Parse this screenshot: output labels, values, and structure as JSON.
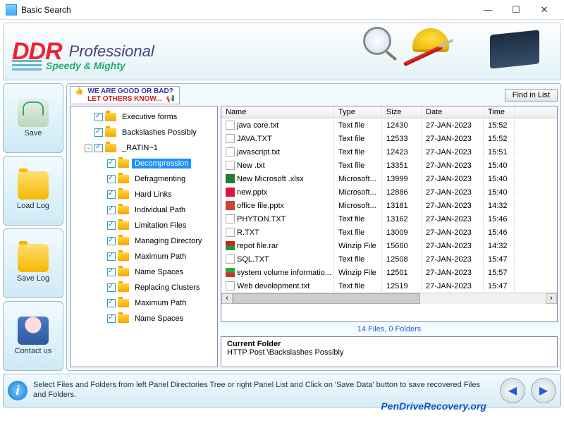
{
  "window": {
    "title": "Basic Search"
  },
  "banner": {
    "brand": "DDR",
    "product": "Professional",
    "slogan": "Speedy & Mighty"
  },
  "sidebar": [
    {
      "label": "Save",
      "icon": "drive"
    },
    {
      "label": "Load Log",
      "icon": "folder"
    },
    {
      "label": "Save Log",
      "icon": "folder"
    },
    {
      "label": "Contact us",
      "icon": "person"
    }
  ],
  "feedback": {
    "line1": "WE ARE GOOD OR BAD?",
    "line2": "LET OTHERS KNOW..."
  },
  "buttons": {
    "find": "Find in List"
  },
  "tree": [
    {
      "label": "Executive forms",
      "indent": 1,
      "exp": ""
    },
    {
      "label": "Backslashes Possibly",
      "indent": 1,
      "exp": ""
    },
    {
      "label": "_RATIN~1",
      "indent": 1,
      "exp": "-"
    },
    {
      "label": "Decompression",
      "indent": 2,
      "exp": "",
      "selected": true
    },
    {
      "label": "Defragmenting",
      "indent": 2,
      "exp": ""
    },
    {
      "label": "Hard Links",
      "indent": 2,
      "exp": ""
    },
    {
      "label": "Individual Path",
      "indent": 2,
      "exp": ""
    },
    {
      "label": "Limitation Files",
      "indent": 2,
      "exp": ""
    },
    {
      "label": "Managing Directory",
      "indent": 2,
      "exp": ""
    },
    {
      "label": "Maximum Path",
      "indent": 2,
      "exp": ""
    },
    {
      "label": "Name Spaces",
      "indent": 2,
      "exp": ""
    },
    {
      "label": "Replacing Clusters",
      "indent": 2,
      "exp": ""
    },
    {
      "label": "Maximum Path",
      "indent": 2,
      "exp": ""
    },
    {
      "label": "Name Spaces",
      "indent": 2,
      "exp": ""
    }
  ],
  "columns": {
    "name": "Name",
    "type": "Type",
    "size": "Size",
    "date": "Date",
    "time": "Time"
  },
  "files": [
    {
      "name": "java core.txt",
      "type": "Text file",
      "size": "12430",
      "date": "27-JAN-2023",
      "time": "15:52",
      "ic": "txt"
    },
    {
      "name": "JAVA.TXT",
      "type": "Text file",
      "size": "12533",
      "date": "27-JAN-2023",
      "time": "15:52",
      "ic": "txt"
    },
    {
      "name": "javascript.txt",
      "type": "Text file",
      "size": "12423",
      "date": "27-JAN-2023",
      "time": "15:51",
      "ic": "txt"
    },
    {
      "name": "New .txt",
      "type": "Text file",
      "size": "13351",
      "date": "27-JAN-2023",
      "time": "15:40",
      "ic": "txt"
    },
    {
      "name": "New Microsoft .xlsx",
      "type": "Microsoft...",
      "size": "13999",
      "date": "27-JAN-2023",
      "time": "15:40",
      "ic": "xls"
    },
    {
      "name": "new.pptx",
      "type": "Microsoft...",
      "size": "12886",
      "date": "27-JAN-2023",
      "time": "15:40",
      "ic": "ppt"
    },
    {
      "name": "office file.pptx",
      "type": "Microsoft...",
      "size": "13181",
      "date": "27-JAN-2023",
      "time": "14:32",
      "ic": "doc"
    },
    {
      "name": "PHYTON.TXT",
      "type": "Text file",
      "size": "13162",
      "date": "27-JAN-2023",
      "time": "15:46",
      "ic": "txt"
    },
    {
      "name": "R.TXT",
      "type": "Text file",
      "size": "13009",
      "date": "27-JAN-2023",
      "time": "15:46",
      "ic": "txt"
    },
    {
      "name": "repot file.rar",
      "type": "Winzip File",
      "size": "15660",
      "date": "27-JAN-2023",
      "time": "14:32",
      "ic": "rar"
    },
    {
      "name": "SQL.TXT",
      "type": "Text file",
      "size": "12508",
      "date": "27-JAN-2023",
      "time": "15:47",
      "ic": "txt"
    },
    {
      "name": "system volume informatio...",
      "type": "Winzip File",
      "size": "12501",
      "date": "27-JAN-2023",
      "time": "15:57",
      "ic": "zip"
    },
    {
      "name": "Web devolopment.txt",
      "type": "Text file",
      "size": "12519",
      "date": "27-JAN-2023",
      "time": "15:47",
      "ic": "txt"
    }
  ],
  "count": "14 Files, 0 Folders",
  "currentFolder": {
    "title": "Current Folder",
    "path": "HTTP Post \\Backslashes Possibly"
  },
  "hint": "Select Files and Folders from left Panel Directories Tree or right Panel List and Click on 'Save Data' button to save recovered Files and Folders.",
  "site": "PenDriveRecovery.org"
}
